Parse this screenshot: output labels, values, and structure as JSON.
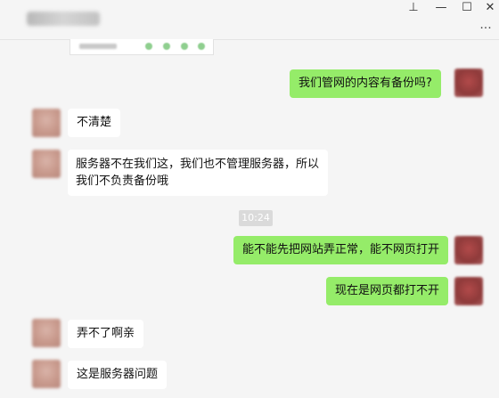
{
  "window": {
    "pin_icon": "⊥",
    "minimize_icon": "—",
    "maximize_icon": "☐",
    "close_icon": "✕",
    "more_icon": "···"
  },
  "messages": [
    {
      "side": "me",
      "text": "我们管网的内容有备份吗?"
    },
    {
      "side": "them",
      "text": "不清楚"
    },
    {
      "side": "them",
      "text": "服务器不在我们这，我们也不管理服务器，所以我们不负责备份哦"
    },
    {
      "side": "time",
      "text": "10:24"
    },
    {
      "side": "me",
      "text": "能不能先把网站弄正常，能不网页打开"
    },
    {
      "side": "me",
      "text": "现在是网页都打不开"
    },
    {
      "side": "them",
      "text": "弄不了啊亲"
    },
    {
      "side": "them",
      "text": "这是服务器问题"
    }
  ],
  "colors": {
    "self_bubble": "#95ec69",
    "other_bubble": "#ffffff",
    "background": "#f5f5f5"
  }
}
